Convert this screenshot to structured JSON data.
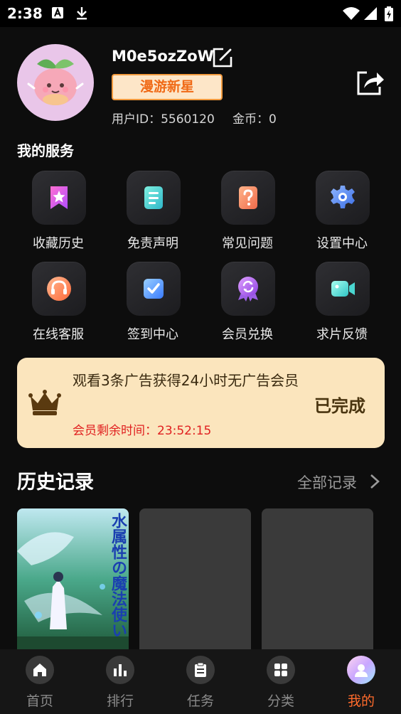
{
  "status_bar": {
    "time": "2:38"
  },
  "profile": {
    "username": "M0e5ozZoW",
    "badge": "漫游新星",
    "user_id": "用户ID：5560120",
    "coins": "金币：0"
  },
  "services": {
    "title": "我的服务",
    "items": [
      {
        "label": "收藏历史",
        "icon": "bookmark-star-icon"
      },
      {
        "label": "免责声明",
        "icon": "document-icon"
      },
      {
        "label": "常见问题",
        "icon": "question-icon"
      },
      {
        "label": "设置中心",
        "icon": "gear-icon"
      },
      {
        "label": "在线客服",
        "icon": "headset-icon"
      },
      {
        "label": "签到中心",
        "icon": "checkin-icon"
      },
      {
        "label": "会员兑换",
        "icon": "exchange-medal-icon"
      },
      {
        "label": "求片反馈",
        "icon": "video-camera-icon"
      }
    ]
  },
  "banner": {
    "text": "观看3条广告获得24小时无广告会员",
    "remaining": "会员剩余时间：23:52:15",
    "status": "已完成",
    "accent": "#fbe5bd"
  },
  "history": {
    "title": "历史记录",
    "all_label": "全部记录",
    "poster_title": "水属性の魔法使い"
  },
  "bottom_nav": {
    "items": [
      {
        "label": "首页",
        "icon": "home-icon"
      },
      {
        "label": "排行",
        "icon": "bar-chart-icon"
      },
      {
        "label": "任务",
        "icon": "clipboard-icon"
      },
      {
        "label": "分类",
        "icon": "grid-icon"
      },
      {
        "label": "我的",
        "icon": "profile-icon"
      }
    ],
    "active_color": "#ff6b2c"
  }
}
